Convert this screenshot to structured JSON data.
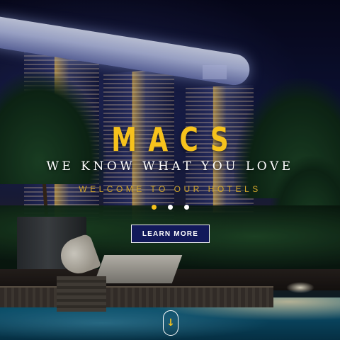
{
  "hero": {
    "brand": "MACS",
    "tagline": "WE KNOW WHAT YOU LOVE",
    "welcome": "WELCOME TO OUR HOTELS",
    "cta_label": "LEARN MORE",
    "slides": {
      "count": 3,
      "active": 1
    },
    "scroll_icon": "arrow-down-icon",
    "scroll_glyph": "↓"
  },
  "colors": {
    "accent": "#f6c21c",
    "button_bg": "#12195a",
    "text": "#ffffff"
  }
}
